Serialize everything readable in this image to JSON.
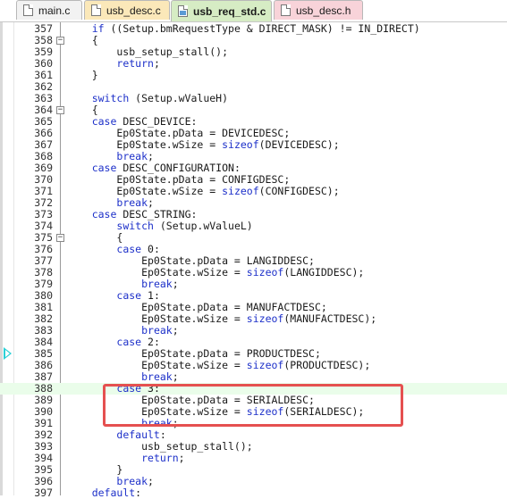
{
  "tabs": [
    {
      "label": "main.c",
      "color": "#f2f2f2",
      "active": false
    },
    {
      "label": "usb_desc.c",
      "color": "#fbe8b9",
      "active": false
    },
    {
      "label": "usb_req_std.c",
      "color": "#d6ecc4",
      "active": true
    },
    {
      "label": "usb_desc.h",
      "color": "#f8d3d9",
      "active": false
    }
  ],
  "current_line": 388,
  "execution_arrow_line": 385,
  "highlighted_lines": [
    388,
    391
  ],
  "lines": [
    {
      "n": 357,
      "code": "    if ((Setup.bmRequestType & DIRECT_MASK) != IN_DIRECT)",
      "fold": false
    },
    {
      "n": 358,
      "code": "    {",
      "fold": true
    },
    {
      "n": 359,
      "code": "        usb_setup_stall();",
      "fold": false
    },
    {
      "n": 360,
      "code": "        return;",
      "fold": false
    },
    {
      "n": 361,
      "code": "    }",
      "fold": false
    },
    {
      "n": 362,
      "code": "",
      "fold": false
    },
    {
      "n": 363,
      "code": "    switch (Setup.wValueH)",
      "fold": false
    },
    {
      "n": 364,
      "code": "    {",
      "fold": true
    },
    {
      "n": 365,
      "code": "    case DESC_DEVICE:",
      "fold": false
    },
    {
      "n": 366,
      "code": "        Ep0State.pData = DEVICEDESC;",
      "fold": false
    },
    {
      "n": 367,
      "code": "        Ep0State.wSize = sizeof(DEVICEDESC);",
      "fold": false
    },
    {
      "n": 368,
      "code": "        break;",
      "fold": false
    },
    {
      "n": 369,
      "code": "    case DESC_CONFIGURATION:",
      "fold": false
    },
    {
      "n": 370,
      "code": "        Ep0State.pData = CONFIGDESC;",
      "fold": false
    },
    {
      "n": 371,
      "code": "        Ep0State.wSize = sizeof(CONFIGDESC);",
      "fold": false
    },
    {
      "n": 372,
      "code": "        break;",
      "fold": false
    },
    {
      "n": 373,
      "code": "    case DESC_STRING:",
      "fold": false
    },
    {
      "n": 374,
      "code": "        switch (Setup.wValueL)",
      "fold": false
    },
    {
      "n": 375,
      "code": "        {",
      "fold": true
    },
    {
      "n": 376,
      "code": "        case 0:",
      "fold": false
    },
    {
      "n": 377,
      "code": "            Ep0State.pData = LANGIDDESC;",
      "fold": false
    },
    {
      "n": 378,
      "code": "            Ep0State.wSize = sizeof(LANGIDDESC);",
      "fold": false
    },
    {
      "n": 379,
      "code": "            break;",
      "fold": false
    },
    {
      "n": 380,
      "code": "        case 1:",
      "fold": false
    },
    {
      "n": 381,
      "code": "            Ep0State.pData = MANUFACTDESC;",
      "fold": false
    },
    {
      "n": 382,
      "code": "            Ep0State.wSize = sizeof(MANUFACTDESC);",
      "fold": false
    },
    {
      "n": 383,
      "code": "            break;",
      "fold": false
    },
    {
      "n": 384,
      "code": "        case 2:",
      "fold": false
    },
    {
      "n": 385,
      "code": "            Ep0State.pData = PRODUCTDESC;",
      "fold": false
    },
    {
      "n": 386,
      "code": "            Ep0State.wSize = sizeof(PRODUCTDESC);",
      "fold": false
    },
    {
      "n": 387,
      "code": "            break;",
      "fold": false
    },
    {
      "n": 388,
      "code": "        case 3:",
      "fold": false
    },
    {
      "n": 389,
      "code": "            Ep0State.pData = SERIALDESC;",
      "fold": false
    },
    {
      "n": 390,
      "code": "            Ep0State.wSize = sizeof(SERIALDESC);",
      "fold": false
    },
    {
      "n": 391,
      "code": "            break;",
      "fold": false
    },
    {
      "n": 392,
      "code": "        default:",
      "fold": false
    },
    {
      "n": 393,
      "code": "            usb_setup_stall();",
      "fold": false
    },
    {
      "n": 394,
      "code": "            return;",
      "fold": false
    },
    {
      "n": 395,
      "code": "        }",
      "fold": false
    },
    {
      "n": 396,
      "code": "        break;",
      "fold": false
    },
    {
      "n": 397,
      "code": "    default:",
      "fold": false
    }
  ],
  "keywords": [
    "if",
    "return",
    "switch",
    "case",
    "break",
    "sizeof",
    "default"
  ],
  "colors": {
    "keyword": "#1d30c9",
    "current_line_bg": "#eafdea",
    "highlight_box": "#e55050",
    "exec_arrow": "#2ad0d6"
  }
}
